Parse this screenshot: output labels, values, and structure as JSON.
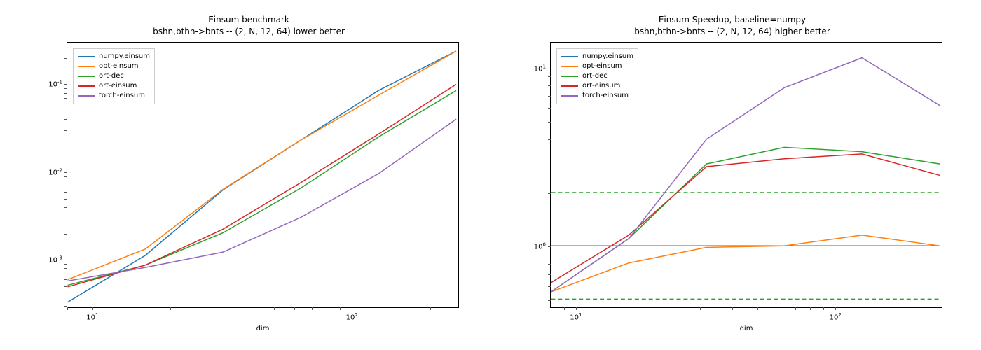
{
  "chart_data": [
    {
      "type": "line",
      "title": "Einsum benchmark\nbshn,bthn->bnts -- (2, N, 12, 64) lower better",
      "xlabel": "dim",
      "ylabel": "",
      "xscale": "log",
      "yscale": "log",
      "xlim": [
        8,
        260
      ],
      "ylim": [
        0.00028,
        0.3
      ],
      "x": [
        8,
        16,
        32,
        64,
        128,
        256
      ],
      "series": [
        {
          "name": "numpy.einsum",
          "color": "#1f77b4",
          "values": [
            0.00032,
            0.0011,
            0.0062,
            0.023,
            0.085,
            0.24
          ]
        },
        {
          "name": "opt-einsum",
          "color": "#ff7f0e",
          "values": [
            0.00058,
            0.0013,
            0.0063,
            0.023,
            0.075,
            0.24
          ]
        },
        {
          "name": "ort-dec",
          "color": "#2ca02c",
          "values": [
            0.0005,
            0.00085,
            0.002,
            0.0065,
            0.025,
            0.085
          ]
        },
        {
          "name": "ort-einsum",
          "color": "#d62728",
          "values": [
            0.00048,
            0.00085,
            0.0022,
            0.0075,
            0.027,
            0.1
          ]
        },
        {
          "name": "torch-einsum",
          "color": "#9467bd",
          "values": [
            0.00056,
            0.0008,
            0.0012,
            0.003,
            0.0095,
            0.04
          ]
        }
      ],
      "yticks": [
        0.001,
        0.01,
        0.1
      ],
      "ytick_labels": [
        "10⁻³",
        "10⁻²",
        "10⁻¹"
      ],
      "xticks": [
        10,
        100
      ],
      "xtick_labels": [
        "10¹",
        "10²"
      ]
    },
    {
      "type": "line",
      "title": "Einsum Speedup, baseline=numpy\nbshn,bthn->bnts -- (2, N, 12, 64) higher better",
      "xlabel": "dim",
      "ylabel": "",
      "xscale": "log",
      "yscale": "log",
      "xlim": [
        8,
        260
      ],
      "ylim": [
        0.45,
        14
      ],
      "x": [
        8,
        16,
        32,
        64,
        128,
        256
      ],
      "series": [
        {
          "name": "numpy.einsum",
          "color": "#1f77b4",
          "values": [
            1.0,
            1.0,
            1.0,
            1.0,
            1.0,
            1.0
          ]
        },
        {
          "name": "opt-einsum",
          "color": "#ff7f0e",
          "values": [
            0.55,
            0.8,
            0.98,
            1.0,
            1.15,
            1.0
          ]
        },
        {
          "name": "ort-dec",
          "color": "#2ca02c",
          "values": [
            0.55,
            1.1,
            2.9,
            3.6,
            3.4,
            2.9
          ]
        },
        {
          "name": "ort-einsum",
          "color": "#d62728",
          "values": [
            0.62,
            1.15,
            2.8,
            3.1,
            3.3,
            2.5
          ]
        },
        {
          "name": "torch-einsum",
          "color": "#9467bd",
          "values": [
            0.55,
            1.1,
            4.0,
            7.8,
            11.5,
            6.2
          ]
        }
      ],
      "hlines": [
        {
          "y": 2.0,
          "color": "#2ca02c",
          "dash": true
        },
        {
          "y": 0.5,
          "color": "#2ca02c",
          "dash": true
        }
      ],
      "yticks": [
        1,
        10
      ],
      "ytick_labels": [
        "10⁰",
        "10¹"
      ],
      "xticks": [
        10,
        100
      ],
      "xtick_labels": [
        "10¹",
        "10²"
      ]
    }
  ]
}
